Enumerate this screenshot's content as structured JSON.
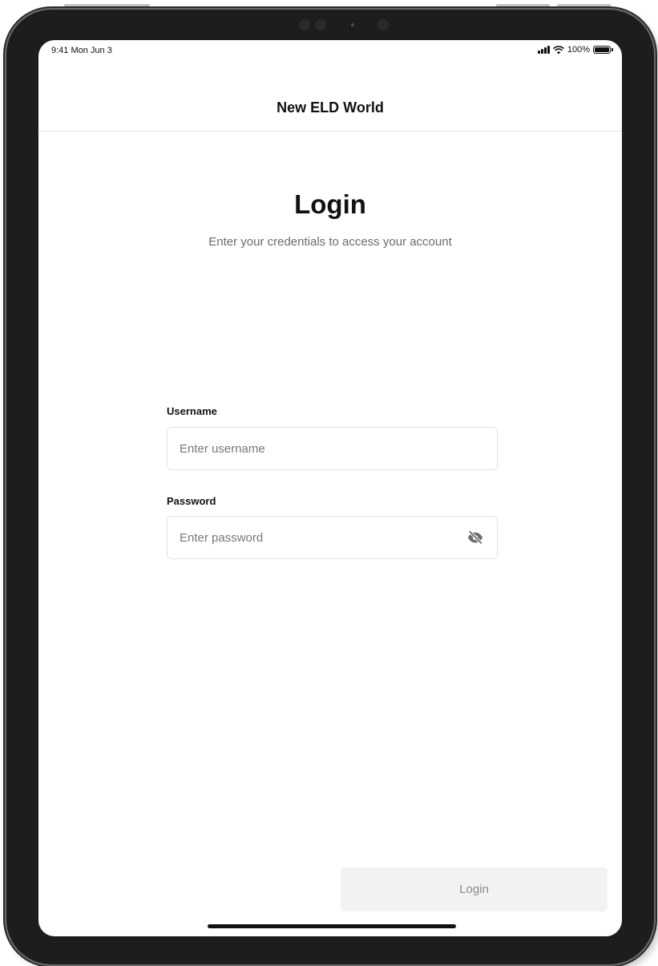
{
  "status_bar": {
    "time": "9:41 Mon Jun 3",
    "battery": "100%"
  },
  "nav": {
    "title": "New ELD World"
  },
  "login": {
    "title": "Login",
    "subtitle": "Enter your credentials to access your account"
  },
  "username": {
    "label": "Username",
    "placeholder": "Enter username",
    "value": ""
  },
  "password": {
    "label": "Password",
    "placeholder": "Enter password",
    "value": "",
    "toggle_icon": "eye-off-icon"
  },
  "actions": {
    "login_label": "Login"
  },
  "colors": {
    "text": "#111111",
    "subtle_text": "#6b6b6b",
    "border": "#e3e3e3",
    "disabled_button_bg": "#f2f2f2",
    "disabled_button_text": "#8a8a8a"
  }
}
